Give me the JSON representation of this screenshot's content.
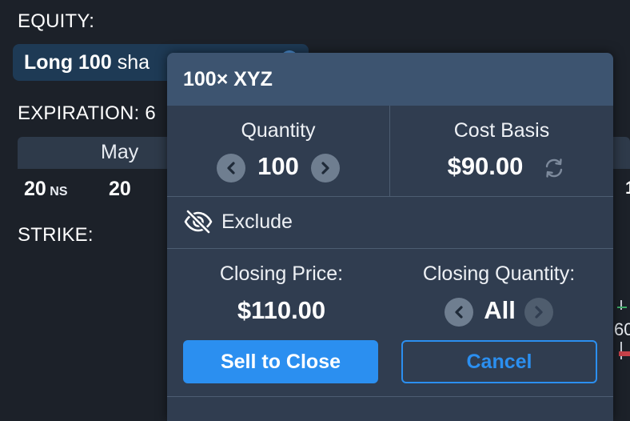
{
  "background": {
    "equity_label": "EQUITY:",
    "equity_position": {
      "prefix": "Long 100",
      "suffix": "sha"
    },
    "expiration_label": "EXPIRATION: 6",
    "month": "May",
    "dates": [
      {
        "day": "20",
        "tag": "NS"
      },
      {
        "day": "20",
        "tag": ""
      }
    ],
    "strike_label": "STRIKE:",
    "edge_day": "1",
    "edge_strike": "60"
  },
  "popup": {
    "title": "100× XYZ",
    "quantity": {
      "label": "Quantity",
      "value": "100"
    },
    "cost_basis": {
      "label": "Cost Basis",
      "value": "$90.00"
    },
    "exclude_label": "Exclude",
    "closing_price": {
      "label": "Closing Price:",
      "value": "$110.00"
    },
    "closing_quantity": {
      "label": "Closing Quantity:",
      "value": "All"
    },
    "buttons": {
      "primary": "Sell to Close",
      "secondary": "Cancel"
    }
  },
  "colors": {
    "background": "#1c2129",
    "popup": "#303d50",
    "header": "#3d5470",
    "accent": "#2b8ff0"
  },
  "icons": [
    "info-icon",
    "chevron-left-icon",
    "chevron-right-icon",
    "refresh-icon",
    "eye-slash-icon"
  ]
}
